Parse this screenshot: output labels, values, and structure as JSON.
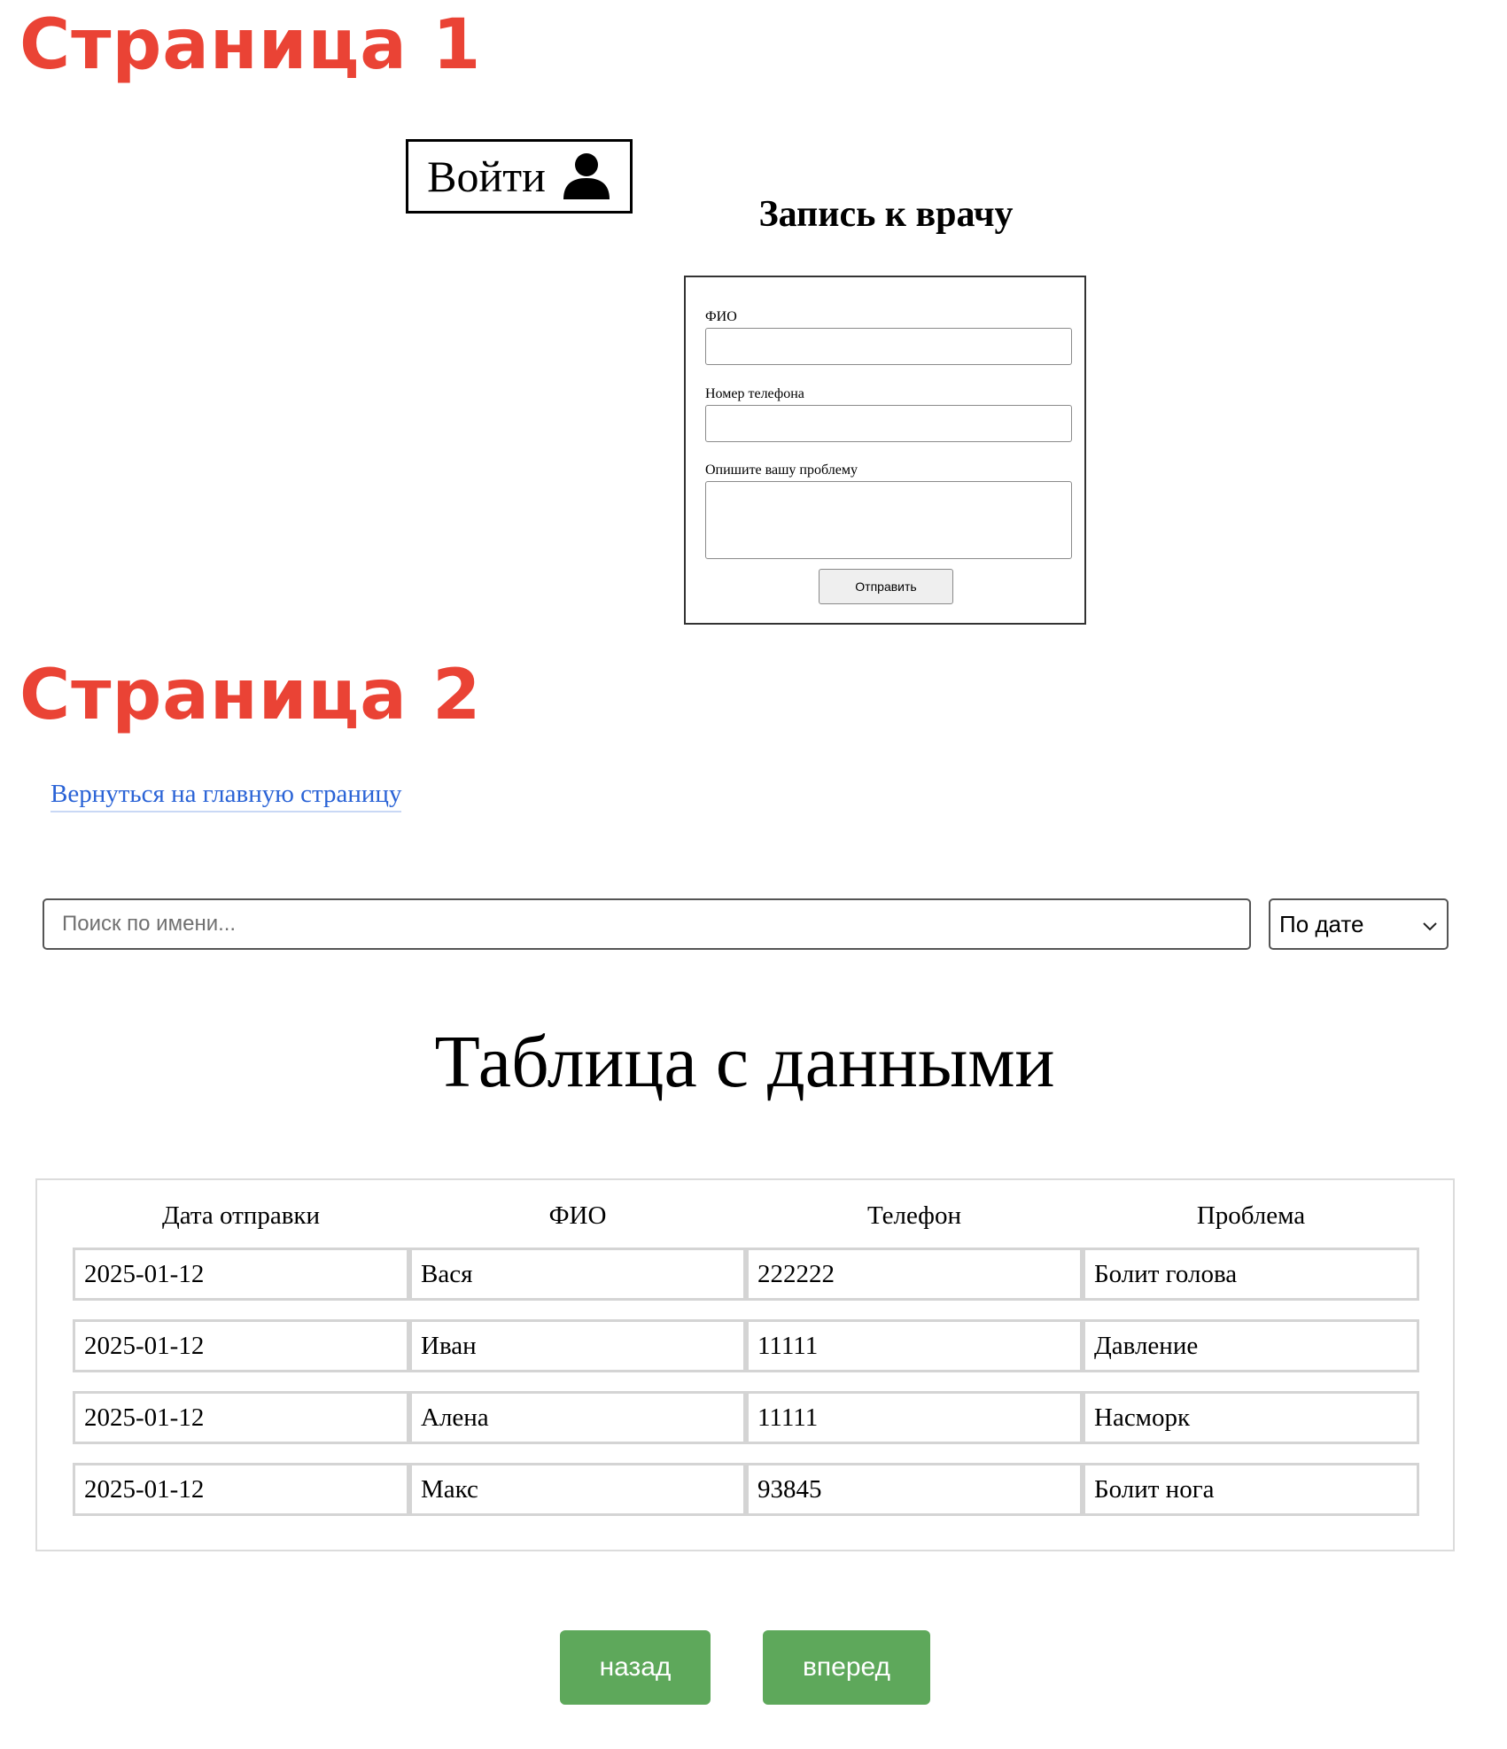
{
  "headings": {
    "page1": "Страница 1",
    "page2": "Страница 2"
  },
  "page1": {
    "login_label": "Войти",
    "login_icon": "user-icon",
    "form_title": "Запись к врачу",
    "fields": {
      "name_label": "ФИО",
      "phone_label": "Номер телефона",
      "problem_label": "Опишите вашу проблему"
    },
    "submit_label": "Отправить"
  },
  "page2": {
    "back_link": "Вернуться на главную страницу",
    "search_placeholder": "Поиск по имени...",
    "sort_selected": "По дате",
    "table_title": "Таблица с данными",
    "table": {
      "columns": [
        "Дата отправки",
        "ФИО",
        "Телефон",
        "Проблема"
      ],
      "rows": [
        [
          "2025-01-12",
          "Вася",
          "222222",
          "Болит голова"
        ],
        [
          "2025-01-12",
          "Иван",
          "11111",
          "Давление"
        ],
        [
          "2025-01-12",
          "Алена",
          "11111",
          "Насморк"
        ],
        [
          "2025-01-12",
          "Макс",
          "93845",
          "Болит нога"
        ]
      ]
    },
    "pagination": {
      "back_label": "назад",
      "forward_label": "вперед"
    }
  },
  "colors": {
    "heading_red": "#ea4335",
    "link_blue": "#2a63d6",
    "button_green": "#5ea85b"
  }
}
